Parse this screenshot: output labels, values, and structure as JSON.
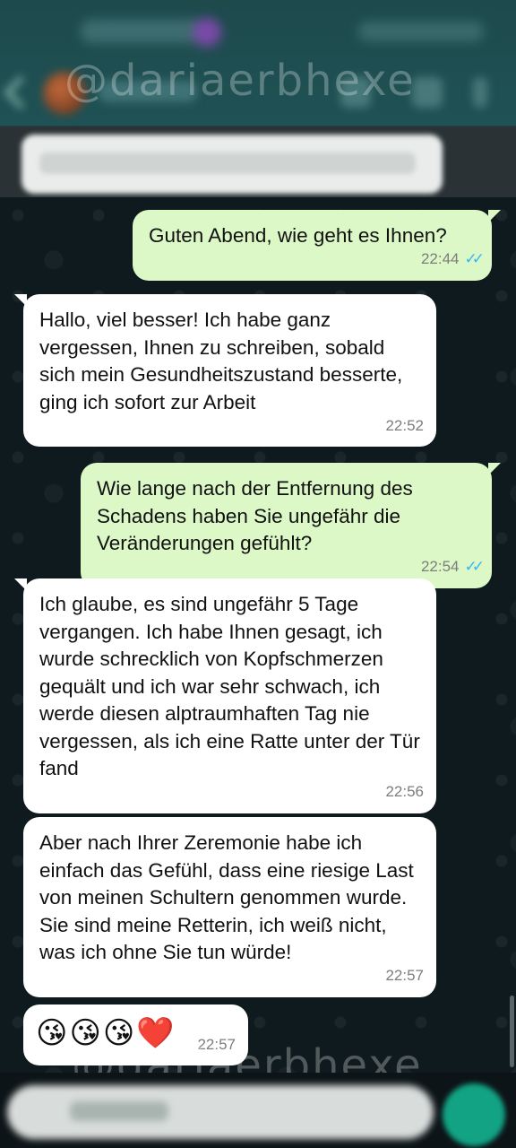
{
  "watermark": "@dariaerbhexe",
  "messages": [
    {
      "direction": "outgoing",
      "text": "Guten Abend, wie geht es Ihnen?",
      "time": "22:44",
      "status": "read"
    },
    {
      "direction": "incoming",
      "text": "Hallo, viel besser! Ich habe ganz vergessen, Ihnen zu schreiben, sobald sich mein Gesundheitszustand besserte, ging ich sofort zur Arbeit",
      "time": "22:52"
    },
    {
      "direction": "outgoing",
      "text": "Wie lange nach der Entfernung des Schadens haben Sie ungefähr die Veränderungen gefühlt?",
      "time": "22:54",
      "status": "read"
    },
    {
      "direction": "incoming",
      "text": "Ich glaube, es sind ungefähr 5 Tage vergangen. Ich habe Ihnen gesagt, ich wurde schrecklich von Kopfschmerzen gequält und ich war sehr schwach, ich werde diesen alptraumhaften Tag nie vergessen, als ich eine Ratte unter der Tür fand",
      "time": "22:56"
    },
    {
      "direction": "incoming",
      "text": "Aber nach Ihrer Zeremonie habe ich einfach das Gefühl, dass eine riesige Last von meinen Schultern genommen wurde. Sie sind meine Retterin, ich weiß nicht, was ich ohne Sie tun würde!",
      "time": "22:57"
    },
    {
      "direction": "incoming",
      "emojis": [
        "😘",
        "😘",
        "😘",
        "❤️"
      ],
      "time": "22:57"
    }
  ],
  "colors": {
    "outgoing_bubble": "#dcf8c6",
    "incoming_bubble": "#ffffff",
    "read_ticks": "#34b7f1",
    "send_button": "#12a384"
  },
  "icons": {
    "read_status": "double-check-icon"
  }
}
